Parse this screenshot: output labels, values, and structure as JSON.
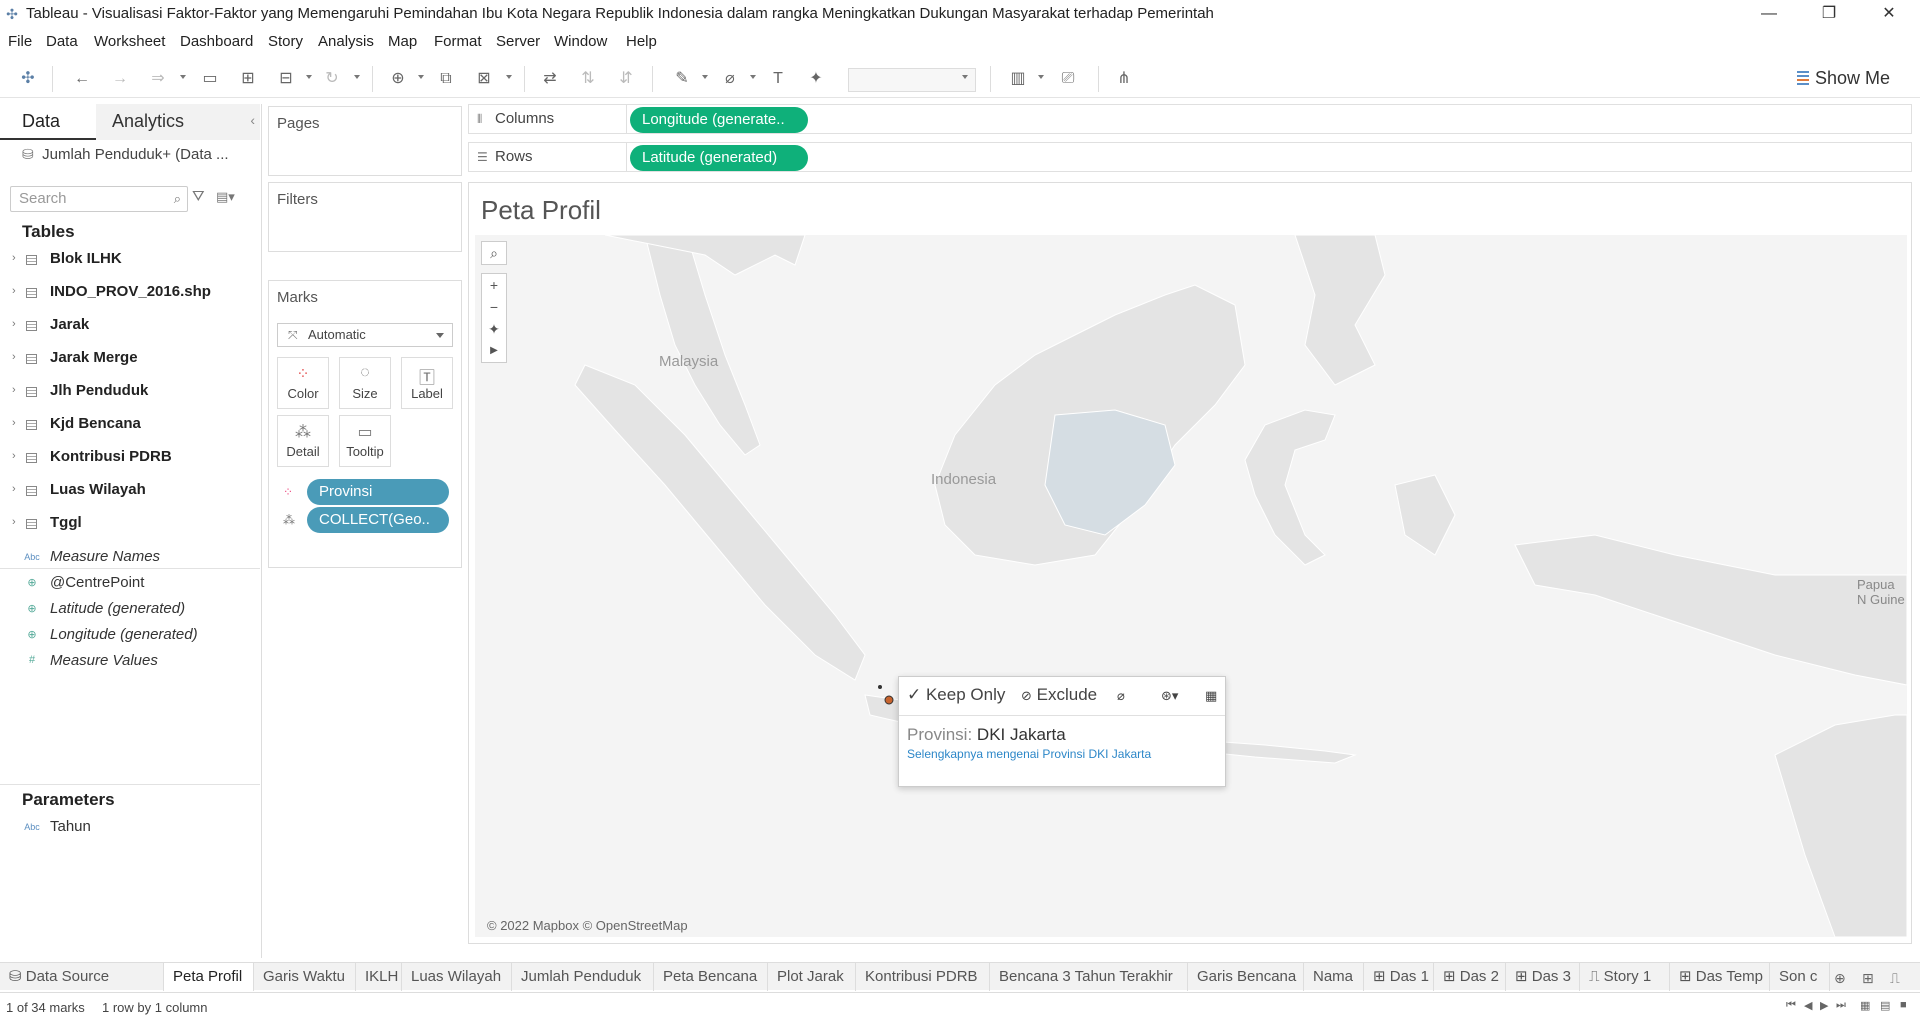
{
  "window": {
    "title": "Tableau - Visualisasi Faktor-Faktor yang Memengaruhi Pemindahan Ibu Kota Negara Republik Indonesia dalam rangka Meningkatkan Dukungan Masyarakat terhadap Pemerintah",
    "minimize": "—",
    "restore": "❐",
    "close": "✕"
  },
  "menu": [
    "File",
    "Data",
    "Worksheet",
    "Dashboard",
    "Story",
    "Analysis",
    "Map",
    "Format",
    "Server",
    "Window",
    "Help"
  ],
  "toolbar": {
    "show_me": "Show Me"
  },
  "datapane": {
    "tab_data": "Data",
    "tab_analytics": "Analytics",
    "datasource": "Jumlah Penduduk+ (Data ...",
    "search_placeholder": "Search",
    "tables_title": "Tables",
    "tables": [
      "Blok ILHK",
      "INDO_PROV_2016.shp",
      "Jarak",
      "Jarak Merge",
      "Jlh Penduduk",
      "Kjd Bencana",
      "Kontribusi PDRB",
      "Luas Wilayah",
      "Tggl"
    ],
    "fields": [
      {
        "icon": "Abc",
        "label": "Measure Names"
      },
      {
        "icon": "⊕",
        "label": "@CentrePoint",
        "italic": false
      },
      {
        "icon": "⊕",
        "label": "Latitude (generated)"
      },
      {
        "icon": "⊕",
        "label": "Longitude (generated)"
      },
      {
        "icon": "#",
        "label": "Measure Values"
      }
    ],
    "parameters_title": "Parameters",
    "parameters": [
      {
        "icon": "Abc",
        "label": "Tahun"
      }
    ]
  },
  "cards": {
    "pages": "Pages",
    "filters": "Filters",
    "marks": "Marks",
    "mark_type": "Automatic",
    "buttons": {
      "color": "Color",
      "size": "Size",
      "label": "Label",
      "detail": "Detail",
      "tooltip": "Tooltip"
    },
    "pills": [
      "Provinsi",
      "COLLECT(Geo.."
    ]
  },
  "shelves": {
    "columns_label": "Columns",
    "rows_label": "Rows",
    "columns_pill": "Longitude (generate..",
    "rows_pill": "Latitude (generated)"
  },
  "viz": {
    "title": "Peta Profil",
    "labels": {
      "malaysia": "Malaysia",
      "indonesia": "Indonesia",
      "papua": "Papua N Guine"
    },
    "attribution": "© 2022 Mapbox © OpenStreetMap"
  },
  "tooltip": {
    "keep_only": "Keep Only",
    "exclude": "Exclude",
    "field_name": "Provinsi:",
    "field_value": "DKI Jakarta",
    "link": "Selengkapnya mengenai Provinsi DKI Jakarta"
  },
  "sheet_tabs": [
    "Data Source",
    "Peta Profil",
    "Garis Waktu",
    "IKLH",
    "Luas Wilayah",
    "Jumlah Penduduk",
    "Peta Bencana",
    "Plot Jarak",
    "Kontribusi PDRB",
    "Bencana 3 Tahun Terakhir",
    "Garis Bencana",
    "Nama",
    "Das 1",
    "Das 2",
    "Das 3",
    "Story 1",
    "Das Temp",
    "Son c"
  ],
  "active_tab": "Peta Profil",
  "status": {
    "marks": "1 of 34 marks",
    "rows": "1 row by 1 column"
  },
  "colors": {
    "pill_blue": "#4a9bb8",
    "pill_green": "#0fb07a",
    "map_land": "#e4e4e4",
    "map_sea": "#f4f4f4",
    "highlight": "#d5dde3"
  }
}
